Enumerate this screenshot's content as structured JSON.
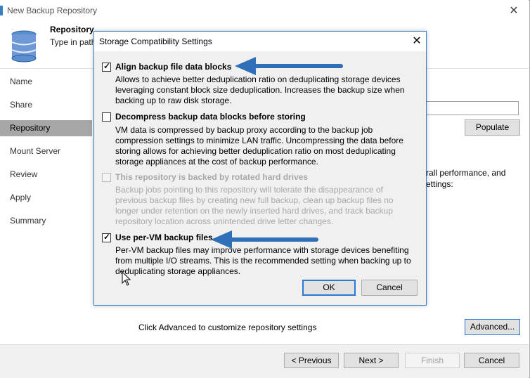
{
  "window": {
    "title": "New Backup Repository"
  },
  "header": {
    "title": "Repository",
    "subtitle": "Type in path"
  },
  "steps": [
    "Name",
    "Share",
    "Repository",
    "Mount Server",
    "Review",
    "Apply",
    "Summary"
  ],
  "active_step": "Repository",
  "content": {
    "populate_label": "Populate",
    "info_line1": "rall performance, and",
    "info_line2": "ettings:",
    "advanced_hint": "Click Advanced to customize repository settings",
    "advanced_label": "Advanced..."
  },
  "footer": {
    "previous": "< Previous",
    "next": "Next >",
    "finish": "Finish",
    "cancel": "Cancel"
  },
  "dialog": {
    "title": "Storage Compatibility Settings",
    "close": "✕",
    "options": [
      {
        "checked": true,
        "disabled": false,
        "title": "Align backup file data blocks",
        "desc": [
          "Allows to achieve better deduplication ratio on deduplicating storage devices",
          "leveraging constant block size deduplication. Increases the backup size when",
          "backing up to raw disk storage."
        ]
      },
      {
        "checked": false,
        "disabled": false,
        "title": "Decompress backup data blocks before storing",
        "desc": [
          "VM data is compressed by backup proxy according to the backup job",
          "compression settings to minimize LAN traffic. Uncompressing the data before",
          "storing allows for achieving better deduplication ratio on most deduplicating",
          "storage appliances at the cost of backup performance."
        ]
      },
      {
        "checked": false,
        "disabled": true,
        "title": "This repository is backed by rotated hard drives",
        "desc": [
          "Backup jobs pointing to this repository will tolerate the disappearance of",
          "previous backup files by creating new full backup, clean up backup files no",
          "longer under retention on the newly inserted hard drives, and track backup",
          "repository location across unintended drive letter changes."
        ]
      },
      {
        "checked": true,
        "disabled": false,
        "title": "Use per-VM backup files",
        "desc": [
          "Per-VM backup files may improve performance with storage devices benefiting",
          "from multiple I/O streams. This is the recommended setting when backing up to",
          "deduplicating storage appliances."
        ]
      }
    ],
    "ok_label": "OK",
    "cancel_label": "Cancel"
  },
  "colors": {
    "accent": "#3c7fc1",
    "arrow": "#2f6fb8",
    "active_step": "#a7a7a7"
  }
}
